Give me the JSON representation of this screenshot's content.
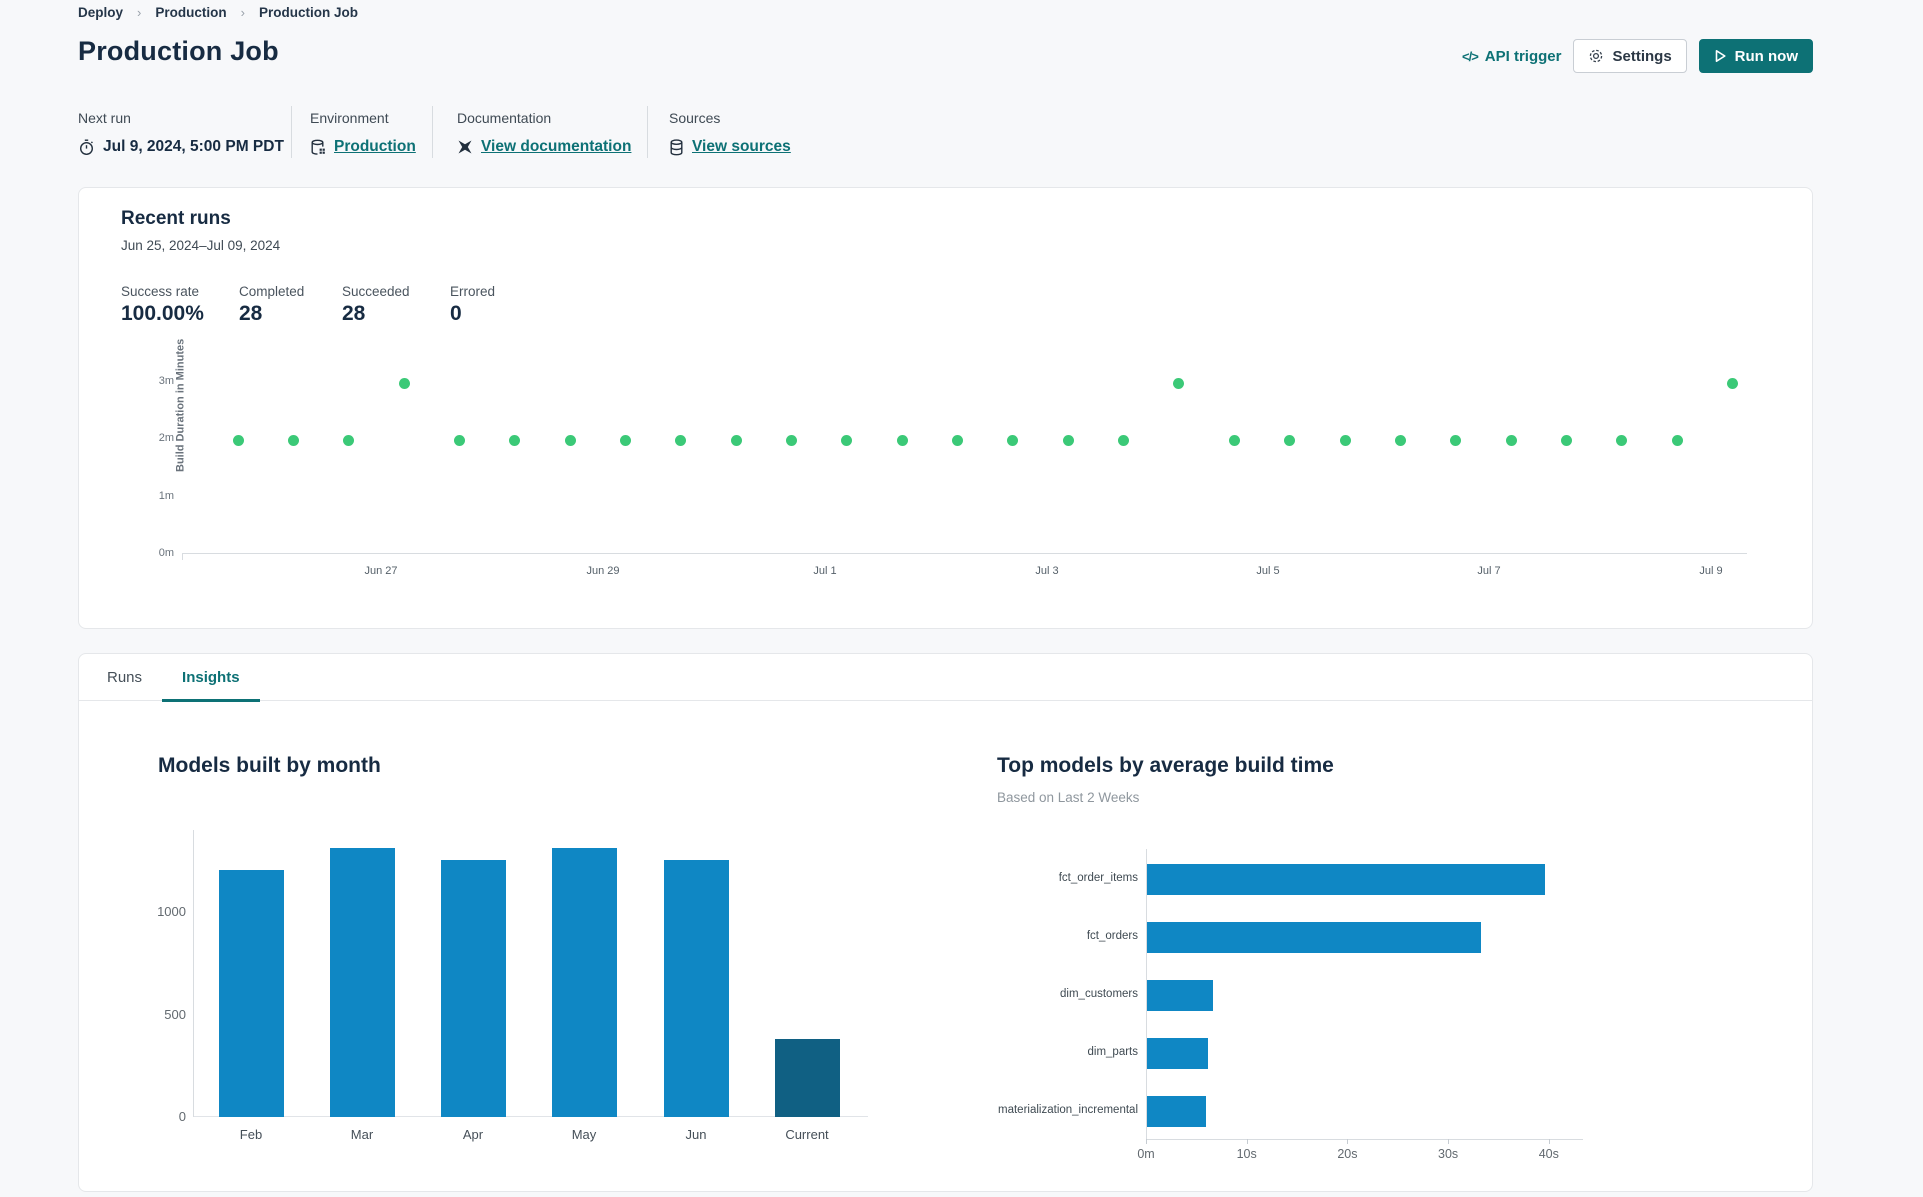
{
  "breadcrumb": {
    "items": [
      "Deploy",
      "Production",
      "Production Job"
    ]
  },
  "page_title": "Production Job",
  "header_actions": {
    "api_trigger": "API trigger",
    "api_glyph": "</>",
    "settings": "Settings",
    "run_now": "Run now"
  },
  "meta": {
    "next_run": {
      "label": "Next run",
      "value": "Jul 9, 2024, 5:00 PM PDT"
    },
    "environment": {
      "label": "Environment",
      "value": "Production"
    },
    "documentation": {
      "label": "Documentation",
      "value": "View documentation"
    },
    "sources": {
      "label": "Sources",
      "value": "View sources"
    }
  },
  "recent_runs": {
    "title": "Recent runs",
    "date_range": "Jun 25, 2024–Jul 09, 2024",
    "stats": [
      {
        "label": "Success rate",
        "value": "100.00%"
      },
      {
        "label": "Completed",
        "value": "28"
      },
      {
        "label": "Succeeded",
        "value": "28"
      },
      {
        "label": "Errored",
        "value": "0"
      }
    ]
  },
  "tabs": [
    {
      "label": "Runs",
      "active": false
    },
    {
      "label": "Insights",
      "active": true
    }
  ],
  "colors": {
    "teal": "#0d7175",
    "green_dot": "#3bc977",
    "bar_blue": "#0f87c4",
    "bar_dark": "#106083"
  },
  "chart_data": [
    {
      "type": "scatter",
      "title": "Recent runs build durations",
      "ylabel": "Build Duration in Minutes",
      "y_ticks": [
        "0m",
        "1m",
        "2m",
        "3m"
      ],
      "x_ticks": [
        "Jun 27",
        "Jun 29",
        "Jul 1",
        "Jul 3",
        "Jul 5",
        "Jul 7",
        "Jul 9"
      ],
      "ylim": [
        0,
        3.2
      ],
      "point_color": "#3bc977",
      "values_minutes": [
        1.95,
        1.95,
        1.95,
        2.95,
        1.95,
        1.95,
        1.95,
        1.95,
        1.95,
        1.95,
        1.95,
        1.95,
        1.95,
        1.95,
        1.95,
        1.95,
        1.95,
        2.95,
        1.95,
        1.95,
        1.95,
        1.95,
        1.95,
        1.95,
        1.95,
        1.95,
        1.95,
        2.95
      ]
    },
    {
      "type": "bar",
      "title": "Models built by month",
      "categories": [
        "Feb",
        "Mar",
        "Apr",
        "May",
        "Jun",
        "Current"
      ],
      "values": [
        1205,
        1310,
        1255,
        1310,
        1255,
        380
      ],
      "y_ticks": [
        0,
        500,
        1000
      ],
      "ylim": [
        0,
        1400
      ],
      "bar_color": "#0f87c4",
      "last_bar_color": "#106083",
      "grid": false,
      "legend": "none"
    },
    {
      "type": "bar",
      "orientation": "horizontal",
      "title": "Top models by average build time",
      "subtitle": "Based on Last 2 Weeks",
      "categories": [
        "fct_order_items",
        "fct_orders",
        "dim_customers",
        "dim_parts",
        "materialization_incremental"
      ],
      "values_seconds": [
        39.5,
        33.2,
        6.5,
        6.1,
        5.9
      ],
      "x_ticks": [
        "0m",
        "10s",
        "20s",
        "30s",
        "40s"
      ],
      "xlim": [
        0,
        43
      ],
      "bar_color": "#0f87c4",
      "grid": false,
      "legend": "none"
    }
  ]
}
